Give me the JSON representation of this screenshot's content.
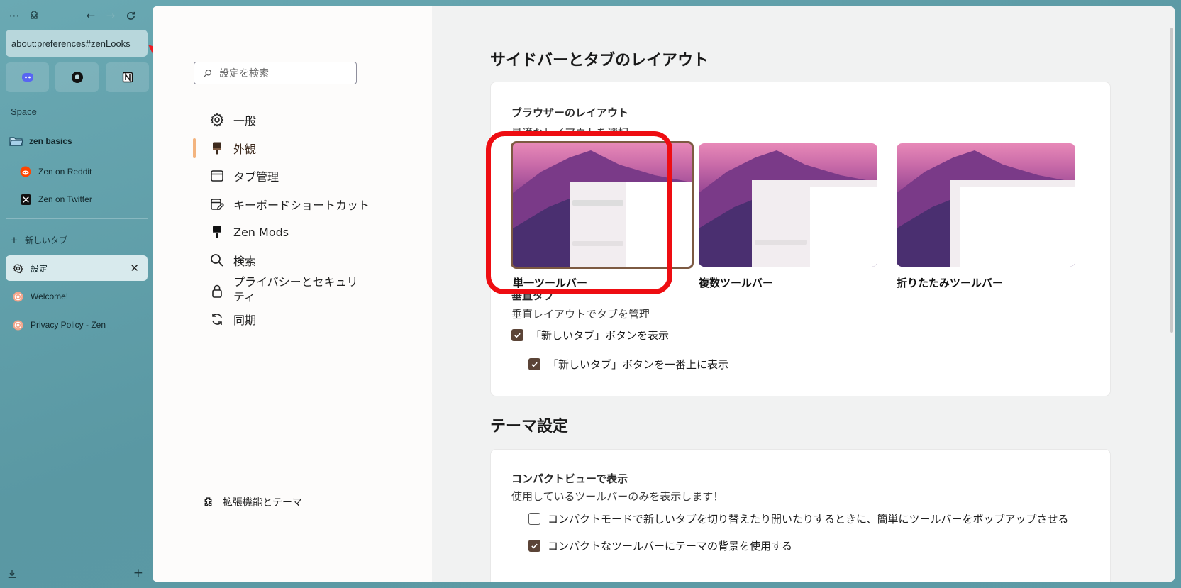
{
  "sidebar": {
    "url": "about:preferences#zenLooks",
    "space_label": "Space",
    "folder": {
      "label": "zen basics"
    },
    "pinned_tabs": [
      {
        "label": "Zen on Reddit",
        "icon": "reddit-icon"
      },
      {
        "label": "Zen on Twitter",
        "icon": "x-twitter-icon"
      }
    ],
    "new_tab_label": "新しいタブ",
    "tabs": [
      {
        "label": "設定",
        "icon": "settings-icon",
        "active": true
      },
      {
        "label": "Welcome!",
        "icon": "zen-logo-icon"
      },
      {
        "label": "Privacy Policy - Zen",
        "icon": "zen-logo-icon"
      }
    ],
    "essentials": [
      "discord-icon",
      "github-icon",
      "notion-icon"
    ]
  },
  "prefs": {
    "search_placeholder": "設定を検索",
    "nav": [
      {
        "label": "一般",
        "icon": "gear-icon"
      },
      {
        "label": "外観",
        "icon": "paintbrush-icon",
        "selected": true
      },
      {
        "label": "タブ管理",
        "icon": "tab-window-icon"
      },
      {
        "label": "キーボードショートカット",
        "icon": "keyboard-edit-icon"
      },
      {
        "label": "Zen Mods",
        "icon": "zen-mods-brush-icon"
      },
      {
        "label": "検索",
        "icon": "search-icon"
      },
      {
        "label": "プライバシーとセキュリティ",
        "icon": "lock-icon"
      },
      {
        "label": "同期",
        "icon": "sync-icon"
      }
    ],
    "footer_label": "拡張機能とテーマ"
  },
  "main": {
    "section1_title": "サイドバーとタブのレイアウト",
    "layout_card": {
      "title": "ブラウザーのレイアウト",
      "desc": "最適なレイアウトを選択",
      "options": [
        {
          "label": "単一ツールバー",
          "selected": true
        },
        {
          "label": "複数ツールバー"
        },
        {
          "label": "折りたたみツールバー"
        }
      ],
      "vertical_title": "垂直タブ",
      "vertical_desc": "垂直レイアウトでタブを管理",
      "check_show_newtab": "「新しいタブ」ボタンを表示",
      "check_newtab_top": "「新しいタブ」ボタンを一番上に表示"
    },
    "section2_title": "テーマ設定",
    "theme_card": {
      "title": "コンパクトビューで表示",
      "desc": "使用しているツールバーのみを表示します！",
      "check_popup": "コンパクトモードで新しいタブを切り替えたり開いたりするときに、簡単にツールバーをポップアップさせる",
      "check_theme_bg": "コンパクトなツールバーにテーマの背景を使用する"
    }
  },
  "colors": {
    "accent": "#5b4437",
    "highlight": "#ee0d12",
    "nav_indicator": "#f3b47f",
    "sidebar_bg": "#5f9ea8"
  }
}
